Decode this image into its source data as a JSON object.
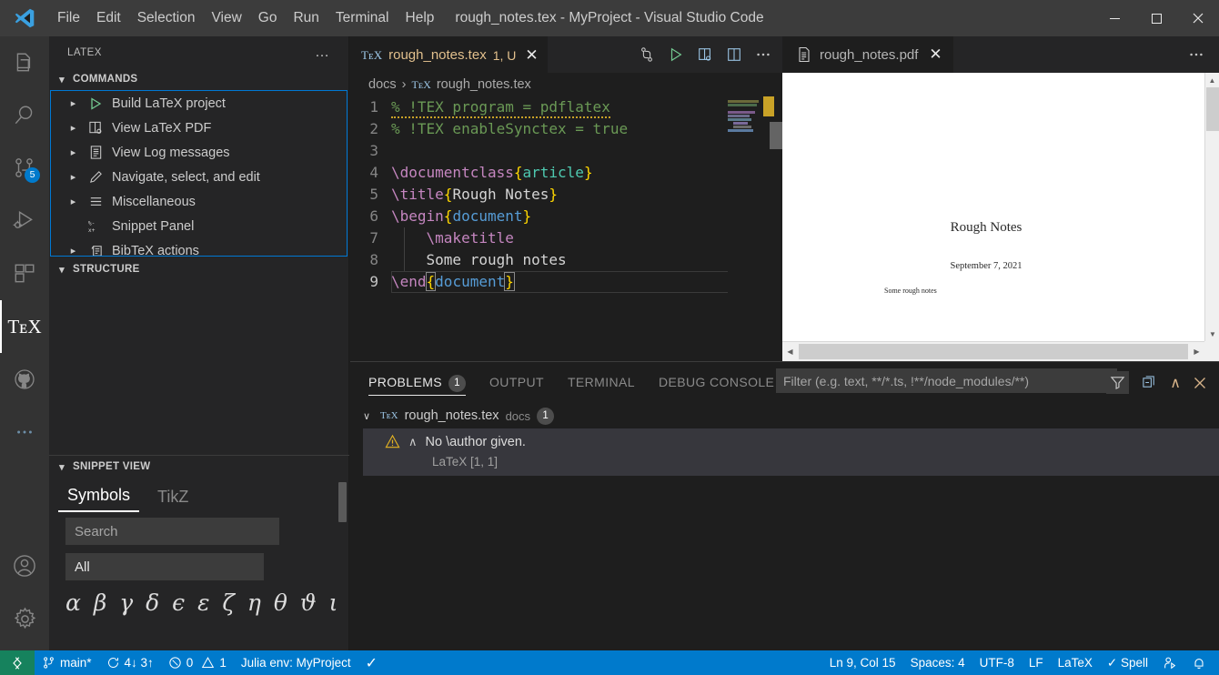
{
  "window": {
    "title": "rough_notes.tex - MyProject - Visual Studio Code",
    "minimize": "—",
    "maximize": "☐",
    "close": "✕"
  },
  "menubar": {
    "items": [
      "File",
      "Edit",
      "Selection",
      "View",
      "Go",
      "Run",
      "Terminal",
      "Help"
    ]
  },
  "activitybar": {
    "source_control_badge": "5",
    "more_label": "•••",
    "tex_label": "TᴇX"
  },
  "sidebar": {
    "title": "LATEX",
    "more_actions": "…",
    "commands_section": "COMMANDS",
    "structure_section": "STRUCTURE",
    "commands": [
      {
        "label": "Build LaTeX project",
        "icon": "play-icon",
        "expandable": true
      },
      {
        "label": "View LaTeX PDF",
        "icon": "view-pdf-icon",
        "expandable": true
      },
      {
        "label": "View Log messages",
        "icon": "log-icon",
        "expandable": true
      },
      {
        "label": "Navigate, select, and edit",
        "icon": "pencil-icon",
        "expandable": true
      },
      {
        "label": "Miscellaneous",
        "icon": "lines-icon",
        "expandable": true
      },
      {
        "label": "Snippet Panel",
        "icon": "snippet-icon",
        "expandable": false
      },
      {
        "label": "BibTeX actions",
        "icon": "bibtex-icon",
        "expandable": true
      }
    ],
    "snippet": {
      "section": "SNIPPET VIEW",
      "tabs": [
        {
          "label": "Symbols",
          "active": true
        },
        {
          "label": "TikZ",
          "active": false
        }
      ],
      "search_placeholder": "Search",
      "search_value": "",
      "category_selected": "All",
      "category_options": [
        "All"
      ],
      "symbols": "α β γ δ ϵ ε ζ η θ ϑ ι κ λ μ"
    }
  },
  "editor": {
    "tab": {
      "filename": "rough_notes.tex",
      "badge": "1, U",
      "tex_icon": "TᴇX",
      "close": "✕"
    },
    "breadcrumb": {
      "folder": "docs",
      "separator": "›",
      "tex_icon": "TᴇX",
      "file": "rough_notes.tex"
    },
    "lines": [
      {
        "num": "1",
        "tokens": [
          {
            "t": "% !TEX program = pdflatex",
            "c": "cm squiggle"
          }
        ]
      },
      {
        "num": "2",
        "tokens": [
          {
            "t": "% !TEX enableSynctex = true",
            "c": "cm"
          }
        ]
      },
      {
        "num": "3",
        "tokens": [
          {
            "t": "",
            "c": ""
          }
        ]
      },
      {
        "num": "4",
        "tokens": [
          {
            "t": "\\documentclass",
            "c": "kw"
          },
          {
            "t": "{",
            "c": "br"
          },
          {
            "t": "article",
            "c": "id"
          },
          {
            "t": "}",
            "c": "br"
          }
        ]
      },
      {
        "num": "5",
        "tokens": [
          {
            "t": "\\title",
            "c": "kw"
          },
          {
            "t": "{",
            "c": "br"
          },
          {
            "t": "Rough Notes",
            "c": ""
          },
          {
            "t": "}",
            "c": "br"
          }
        ]
      },
      {
        "num": "6",
        "tokens": [
          {
            "t": "\\begin",
            "c": "kw"
          },
          {
            "t": "{",
            "c": "br"
          },
          {
            "t": "document",
            "c": "cls"
          },
          {
            "t": "}",
            "c": "br"
          }
        ]
      },
      {
        "num": "7",
        "tokens": [
          {
            "t": "    ",
            "c": ""
          },
          {
            "t": "\\maketitle",
            "c": "kw"
          }
        ]
      },
      {
        "num": "8",
        "tokens": [
          {
            "t": "    Some rough notes",
            "c": ""
          }
        ]
      },
      {
        "num": "9",
        "tokens": [
          {
            "t": "\\end",
            "c": "kw"
          },
          {
            "t": "{",
            "c": "br brkt"
          },
          {
            "t": "document",
            "c": "cls"
          },
          {
            "t": "}",
            "c": "br brkt"
          }
        ]
      }
    ]
  },
  "pdf": {
    "tab_name": "rough_notes.pdf",
    "close": "✕",
    "more_actions": "…",
    "document": {
      "title": "Rough Notes",
      "date": "September 7, 2021",
      "body": "Some rough notes"
    }
  },
  "panel": {
    "tabs": [
      {
        "label": "PROBLEMS",
        "count": "1",
        "active": true
      },
      {
        "label": "OUTPUT",
        "count": "",
        "active": false
      },
      {
        "label": "TERMINAL",
        "count": "",
        "active": false
      },
      {
        "label": "DEBUG CONSOLE",
        "count": "",
        "active": false
      }
    ],
    "filter_placeholder": "Filter (e.g. text, **/*.ts, !**/node_modules/**)",
    "filter_value": "",
    "collapse_chevron": "∧",
    "close": "✕",
    "problem_file": {
      "name": "rough_notes.tex",
      "folder": "docs",
      "count": "1",
      "tex_icon": "TᴇX",
      "chevron": "∨"
    },
    "problem": {
      "message": "No \\author given.",
      "expand_caret": "∧",
      "source": "LaTeX  [1, 1]"
    }
  },
  "statusbar": {
    "branch": "main*",
    "sync": "4↓ 3↑",
    "errors": "0",
    "warnings": "1",
    "julia_env": "Julia env: MyProject",
    "check": "✓",
    "cursor": "Ln 9, Col 15",
    "spaces": "Spaces: 4",
    "encoding": "UTF-8",
    "eol": "LF",
    "language": "LaTeX",
    "spell": "✓ Spell"
  },
  "colors": {
    "accent": "#007acc",
    "remote": "#16825d",
    "warning": "#e2c08d",
    "focus_border": "#0078d4",
    "build_green": "#73c991"
  }
}
